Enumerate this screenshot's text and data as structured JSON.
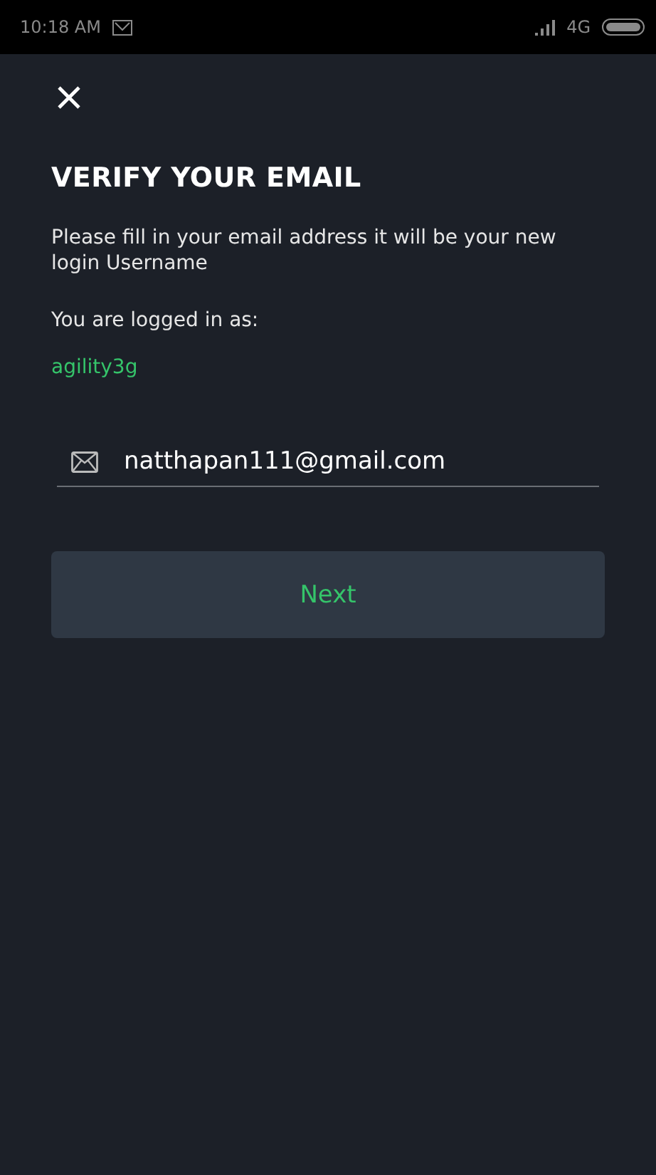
{
  "status_bar": {
    "time": "10:18 AM",
    "network": "4G"
  },
  "title": "VERIFY YOUR EMAIL",
  "description": "Please fill in your email address it will be your new login Username",
  "logged_in_label": "You are logged in as:",
  "username": "agility3g",
  "email_field": {
    "value": "natthapan111@gmail.com"
  },
  "buttons": [
    "Next"
  ]
}
